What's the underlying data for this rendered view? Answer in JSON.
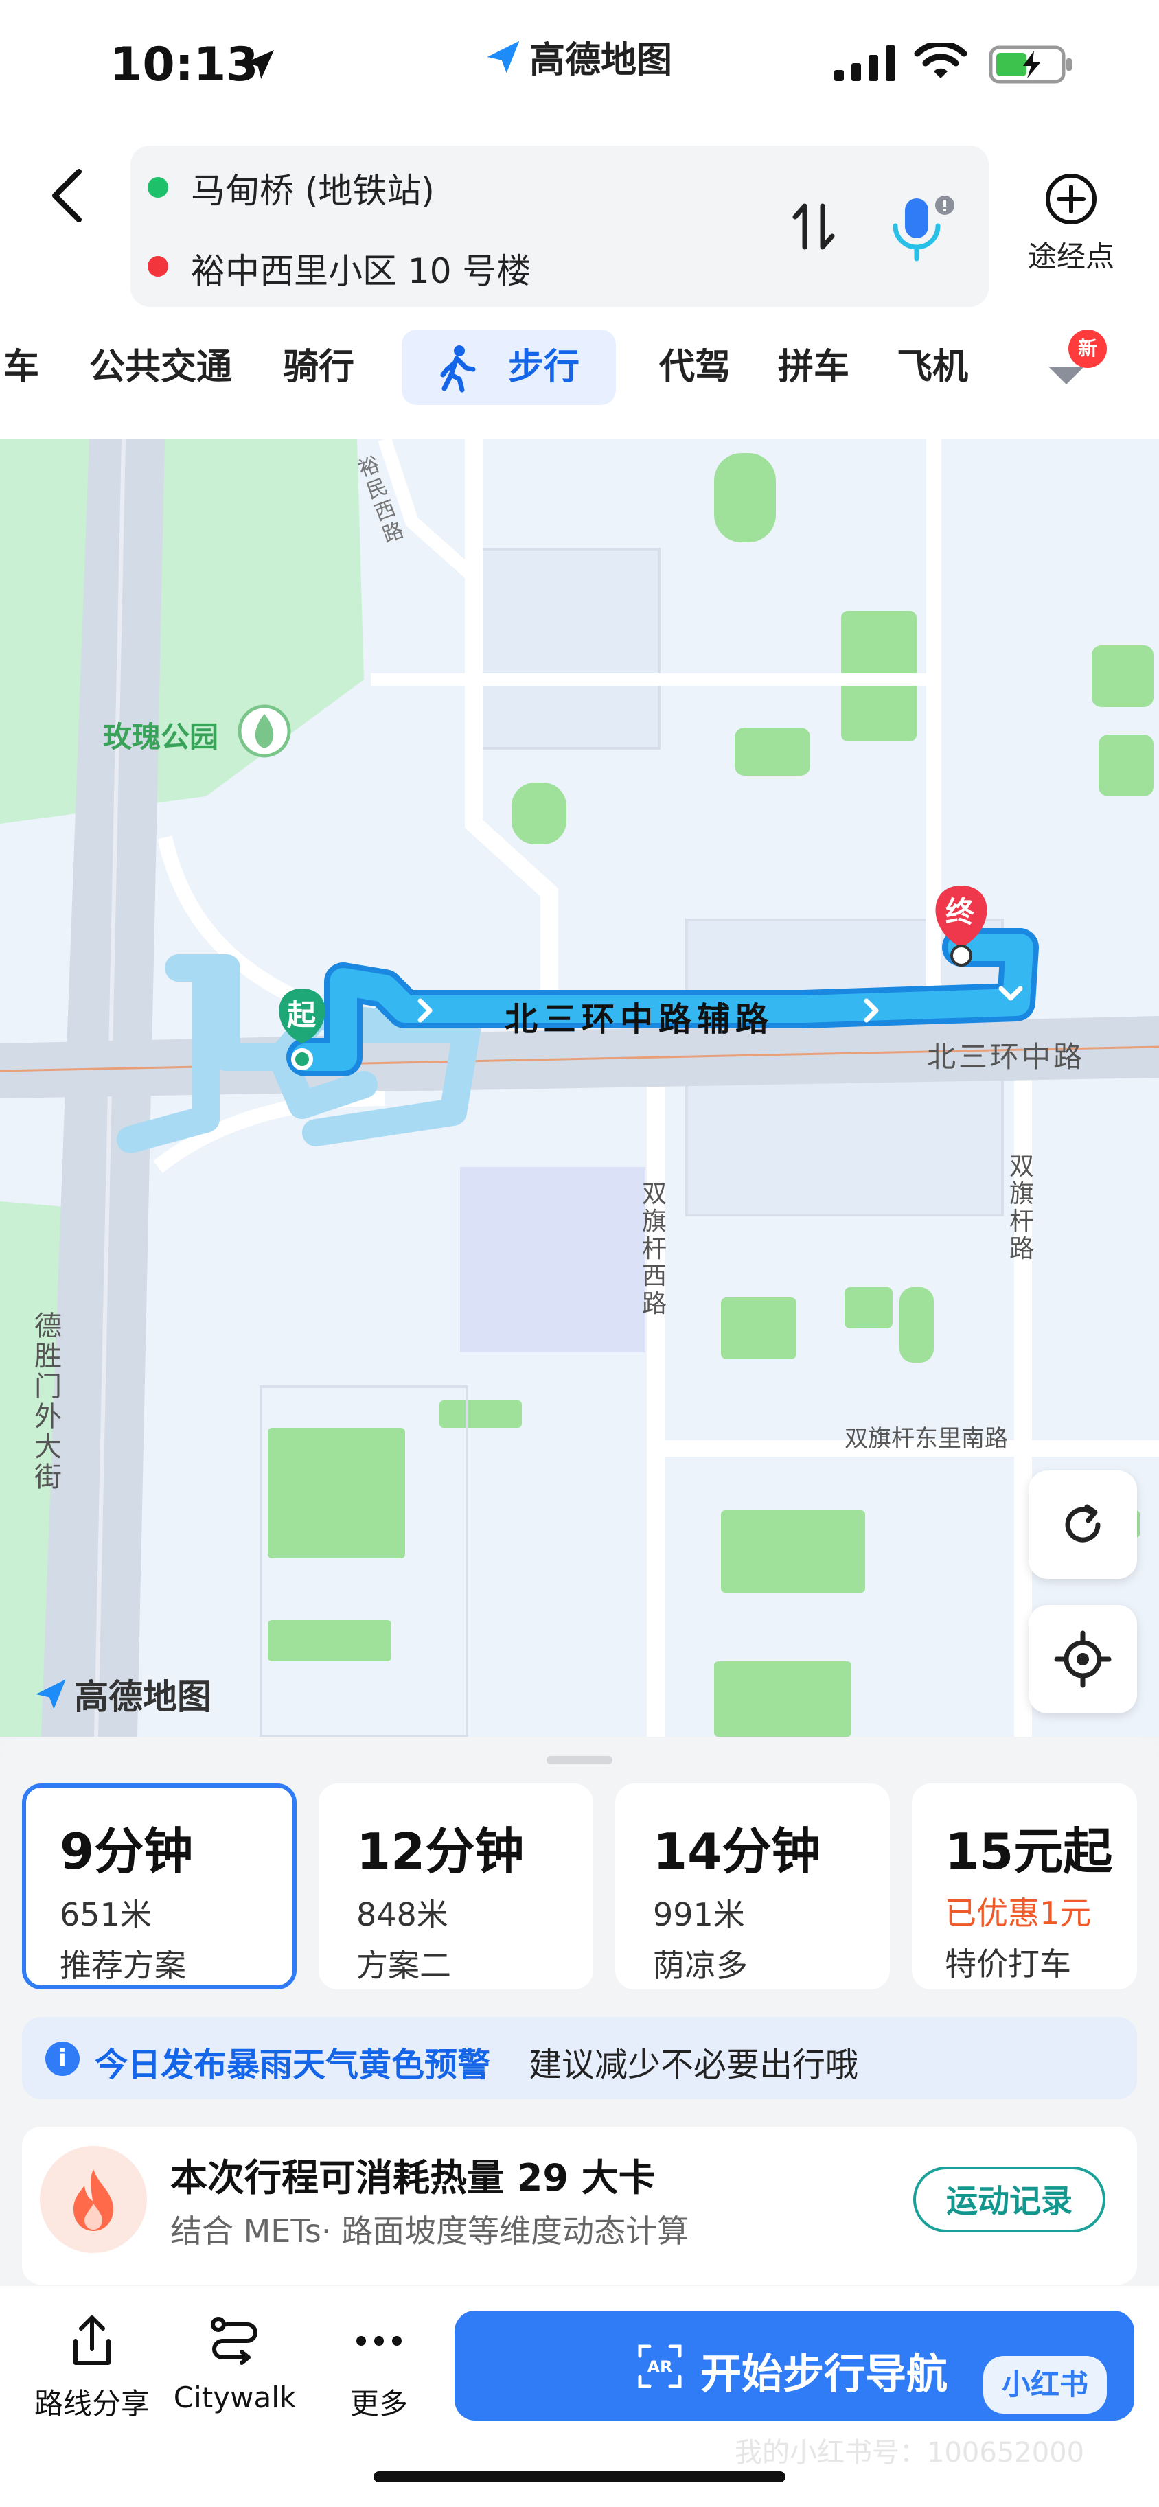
{
  "status_bar": {
    "time": "10:13",
    "app_brand": "高德地图"
  },
  "route": {
    "origin": "马甸桥 (地铁站)",
    "destination": "裕中西里小区 10 号楼",
    "waypoint_label": "途经点"
  },
  "tabs": [
    {
      "label": "车"
    },
    {
      "label": "公共交通"
    },
    {
      "label": "骑行"
    },
    {
      "label": "步行",
      "active": true
    },
    {
      "label": "代驾"
    },
    {
      "label": "拼车"
    },
    {
      "label": "飞机"
    }
  ],
  "new_badge": "新",
  "map": {
    "park": "玫瑰公园",
    "road_route": "北三环中路辅路",
    "road_main": "北三环中路",
    "road_left": "德胜门外大街",
    "road_shuangqi_west": "双旗杆西路",
    "road_shuangqi": "双旗杆路",
    "road_shuangqi_east": "双旗杆东里南路",
    "road_top": "裕民西路",
    "start_marker": "起",
    "end_marker": "终",
    "logo": "高德地图"
  },
  "options": [
    {
      "time": "9分钟",
      "distance": "651米",
      "note": "推荐方案",
      "selected": true
    },
    {
      "time": "12分钟",
      "distance": "848米",
      "note": "方案二"
    },
    {
      "time": "14分钟",
      "distance": "991米",
      "note": "荫凉多"
    },
    {
      "time": "15元起",
      "distance": "已优惠1元",
      "note": "特价打车"
    }
  ],
  "alert": {
    "highlight": "今日发布暴雨天气黄色预警",
    "text": "建议减少不必要出行哦"
  },
  "calorie": {
    "title": "本次行程可消耗热量 29 大卡",
    "subtitle": "结合 METs· 路面坡度等维度动态计算",
    "button": "运动记录"
  },
  "footer": {
    "share": "路线分享",
    "citywalk": "Citywalk",
    "more": "更多",
    "start": "开始步行导航",
    "xhs": "小红书",
    "watermark": "我的小红书号：100652000"
  },
  "colors": {
    "accent": "#2f7cf6",
    "route": "#29a9f0",
    "start": "#1fa877",
    "end": "#f0384c"
  }
}
